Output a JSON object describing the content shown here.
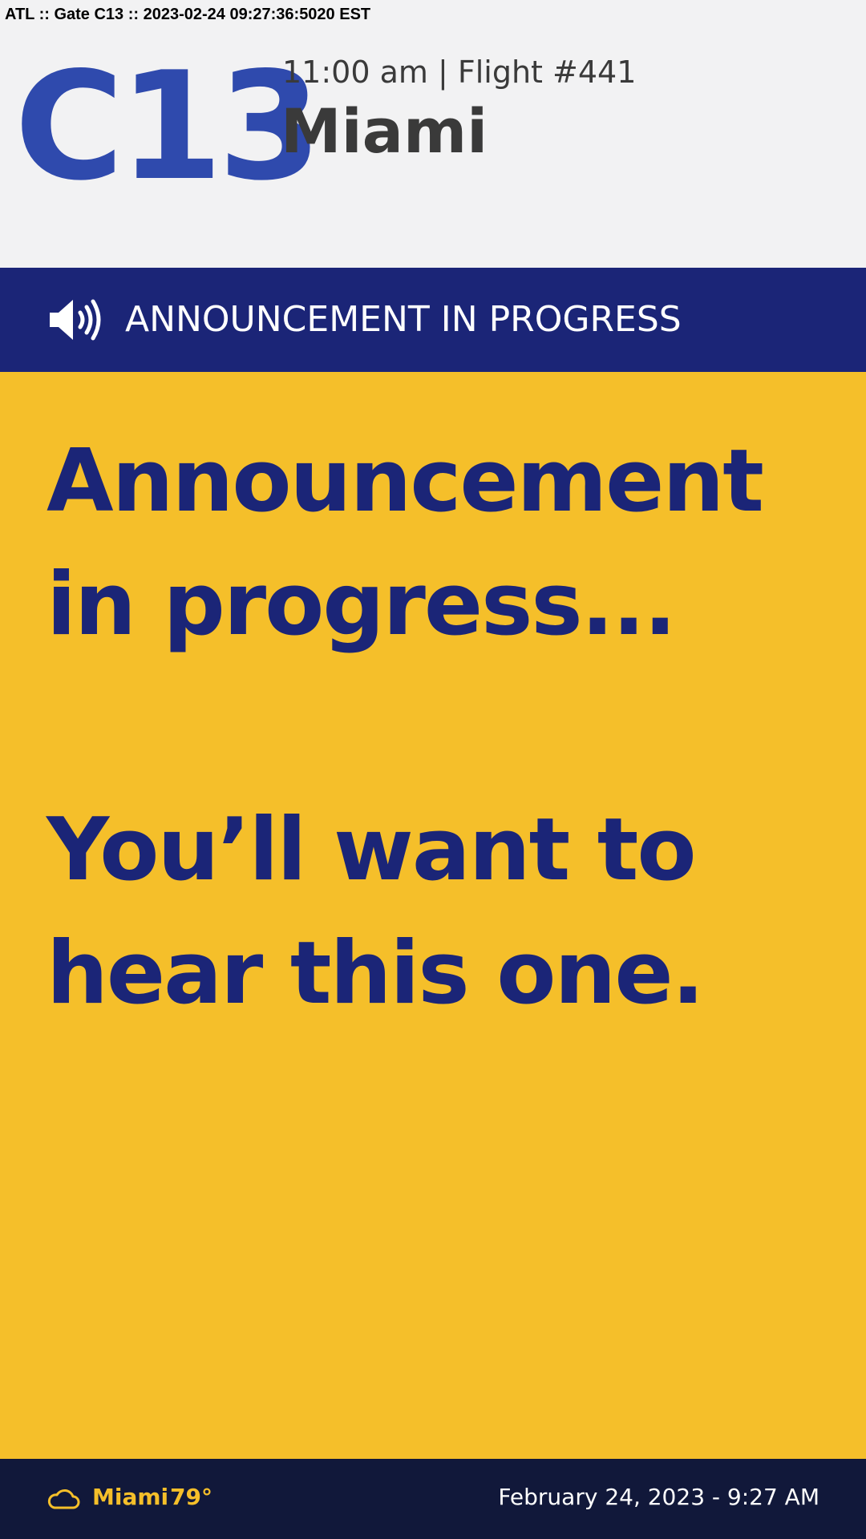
{
  "debug_line": "ATL :: Gate C13 :: 2023-02-24 09:27:36:5020 EST",
  "header": {
    "gate": "C13",
    "flight_line": "11:00 am | Flight #441",
    "destination": "Miami"
  },
  "banner": {
    "icon": "speaker-icon",
    "text": "ANNOUNCEMENT IN PROGRESS"
  },
  "main": {
    "message_1_line_1": "Announcement",
    "message_1_line_2": "in progress...",
    "message_2_line_1": "You’ll want to",
    "message_2_line_2": "hear this one."
  },
  "footer": {
    "weather_icon": "cloud-icon",
    "weather_city": "Miami",
    "weather_temp": "79°",
    "datetime": "February 24, 2023 - 9:27 AM"
  },
  "colors": {
    "gate_blue": "#2f4aad",
    "banner_navy": "#1b2577",
    "main_yellow": "#f5bf2a",
    "footer_navy": "#11183a",
    "header_bg": "#f2f2f3",
    "text_dark": "#3a3a3a"
  }
}
